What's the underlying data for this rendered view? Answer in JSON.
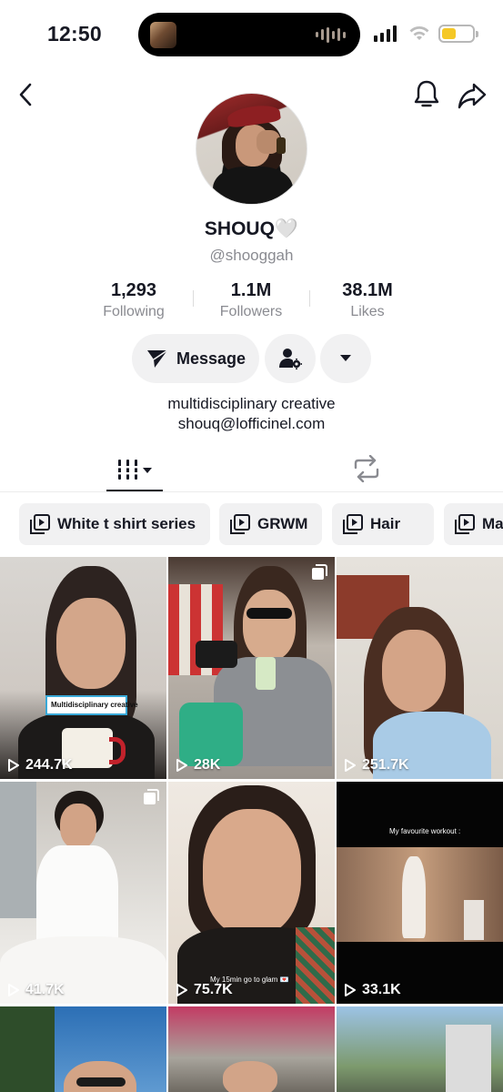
{
  "status_bar": {
    "time": "12:50"
  },
  "profile": {
    "name": "SHOUQ🤍",
    "handle": "@shooggah",
    "stats": [
      {
        "value": "1,293",
        "label": "Following"
      },
      {
        "value": "1.1M",
        "label": "Followers"
      },
      {
        "value": "38.1M",
        "label": "Likes"
      }
    ],
    "message_label": "Message",
    "bio_lines": [
      "multidisciplinary creative",
      "shouq@lofficinel.com"
    ]
  },
  "icons": {
    "back": "chevron-left-icon",
    "notifications": "bell-icon",
    "share": "share-arrow-icon",
    "add_friend": "person-gear-icon",
    "more": "caret-down-icon",
    "videos_tab": "grid-bars-icon",
    "reposts_tab": "repost-icon",
    "playlist": "playlist-play-icon",
    "views": "play-icon",
    "multi": "carousel-icon"
  },
  "playlists": [
    "White t shirt series",
    "GRWM",
    "Hair",
    "Ma"
  ],
  "videos": [
    {
      "views": "244.7K",
      "caption": "Multidisciplinary creative"
    },
    {
      "views": "28K",
      "caption": ""
    },
    {
      "views": "251.7K",
      "caption": ""
    },
    {
      "views": "41.7K",
      "caption": ""
    },
    {
      "views": "75.7K",
      "caption": "My 15min go to glam 💌"
    },
    {
      "views": "33.1K",
      "caption": "My favourite workout :"
    },
    {
      "views": "",
      "caption": ""
    },
    {
      "views": "",
      "caption": ""
    },
    {
      "views": "",
      "caption": ""
    }
  ],
  "colors": {
    "text": "#161823",
    "secondary": "#8a8b91",
    "button_bg": "#f1f1f2",
    "battery": "#f5c826"
  }
}
